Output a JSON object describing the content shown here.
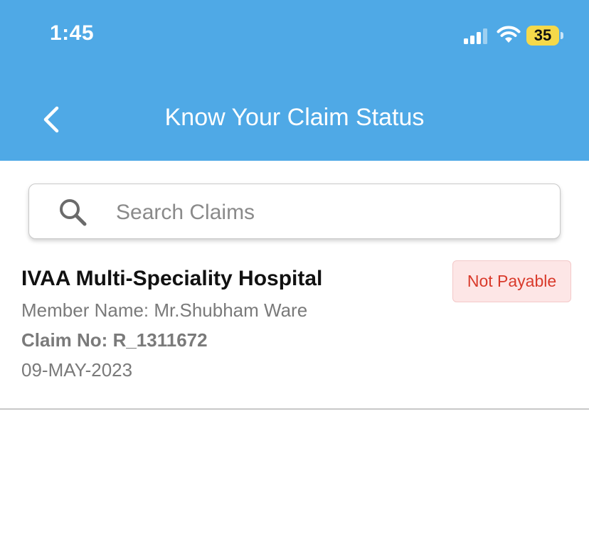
{
  "status_bar": {
    "time": "1:45",
    "battery_level": "35",
    "battery_color": "#f5d94a",
    "icons": [
      "signal-icon",
      "wifi-icon",
      "battery-icon"
    ]
  },
  "header": {
    "title": "Know Your Claim Status",
    "background_color": "#4fa9e6",
    "back_icon": "chevron-left-icon"
  },
  "search": {
    "placeholder": "Search Claims",
    "value": "",
    "icon": "search-icon"
  },
  "claims": [
    {
      "hospital": "IVAA Multi-Speciality Hospital",
      "member": "Member Name: Mr.Shubham Ware",
      "claim_no": "Claim No: R_1311672",
      "date": "09-MAY-2023",
      "status": "Not Payable",
      "status_color": "#d93a2b"
    }
  ]
}
